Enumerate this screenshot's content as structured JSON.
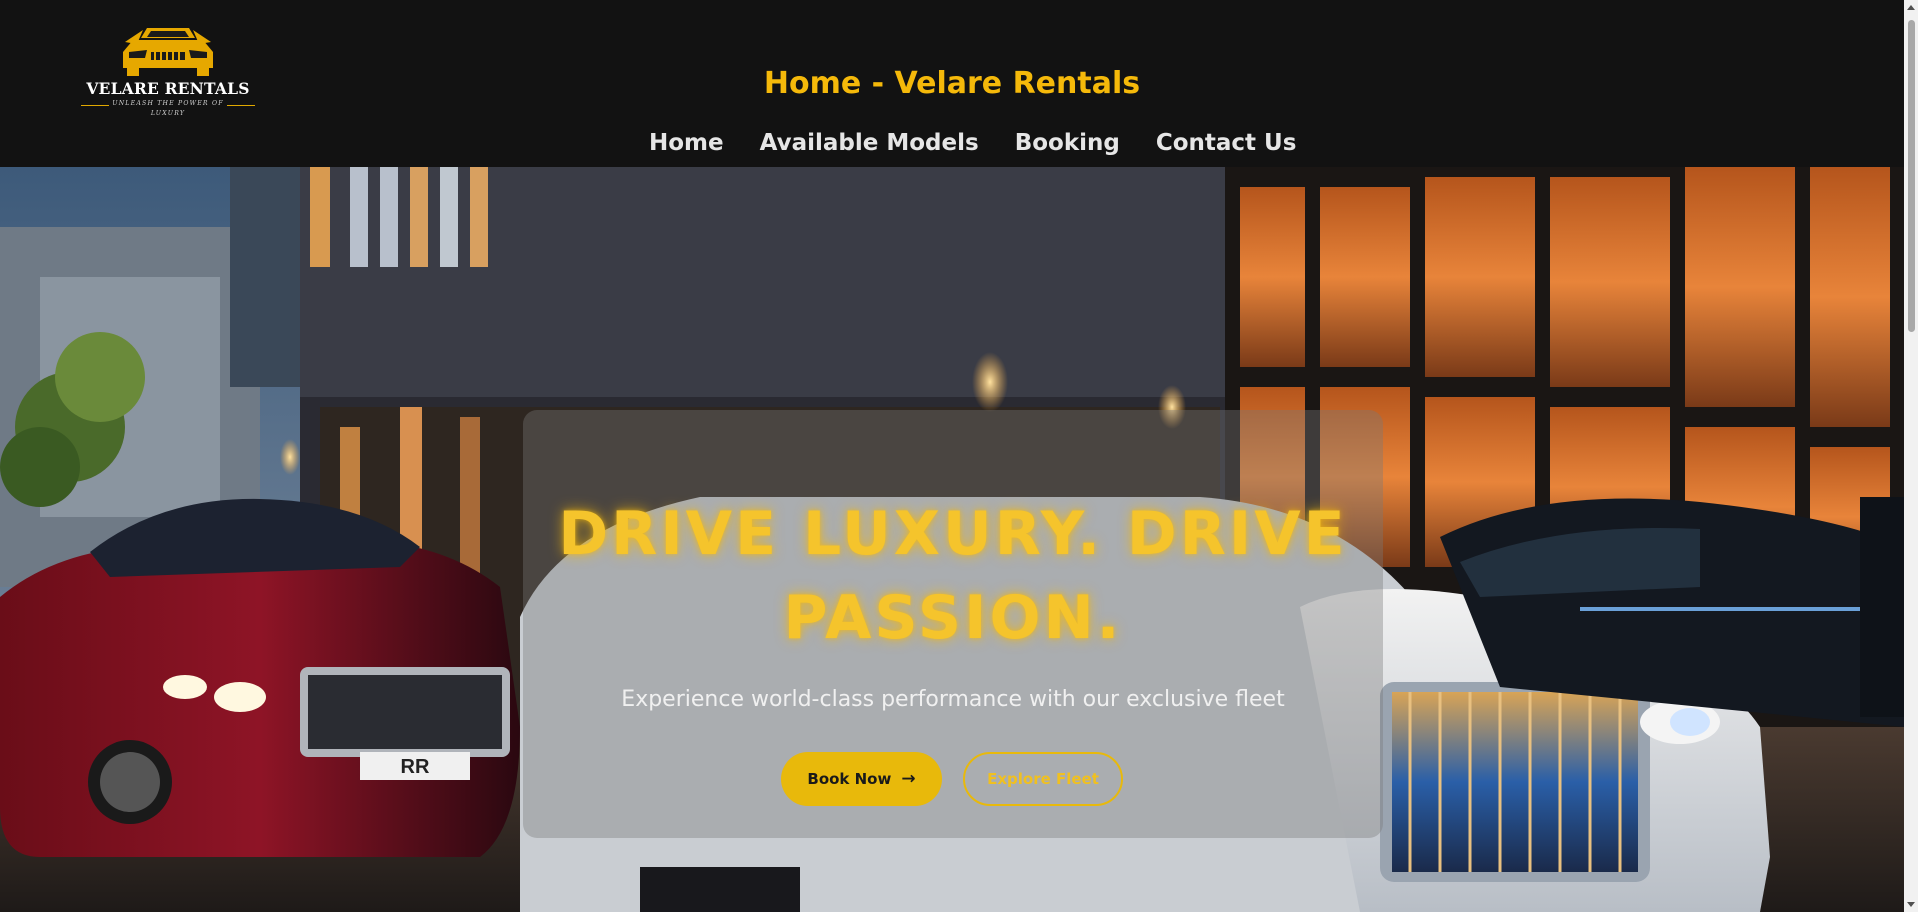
{
  "brand": {
    "name": "VELARE RENTALS",
    "tagline": "UNLEASH THE POWER OF LUXURY",
    "logo_icon": "luxury-car-front-icon",
    "accent_color": "#f5b90a"
  },
  "header": {
    "title": "Home - Velare Rentals"
  },
  "nav": {
    "items": [
      {
        "label": "Home"
      },
      {
        "label": "Available Models"
      },
      {
        "label": "Booking"
      },
      {
        "label": "Contact Us"
      }
    ]
  },
  "hero": {
    "headline": "DRIVE LUXURY. DRIVE PASSION.",
    "subheadline": "Experience world-class performance with our exclusive fleet",
    "primary_button": "Book Now",
    "primary_button_icon": "arrow-right-icon",
    "secondary_button": "Explore Fleet",
    "background": "luxury cars parked outside a lit building at dusk",
    "license_plate": "RR"
  }
}
